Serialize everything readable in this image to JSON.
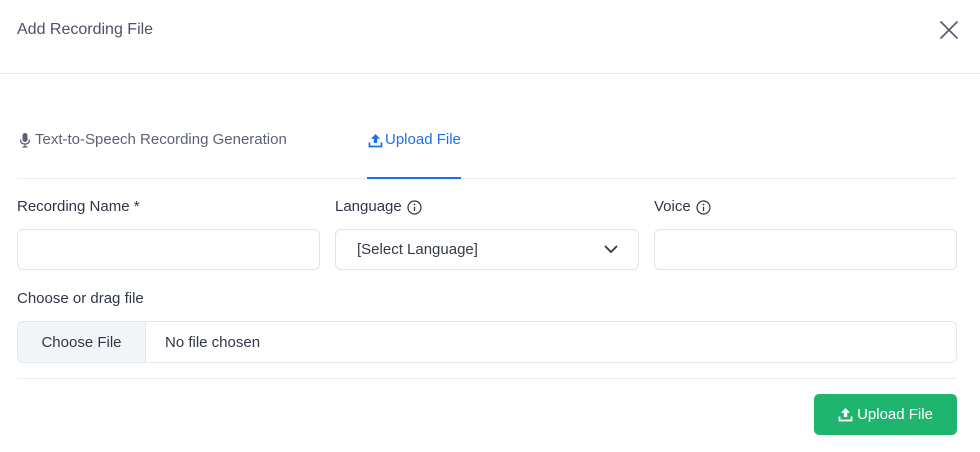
{
  "dialog": {
    "title": "Add Recording File"
  },
  "tabs": [
    {
      "label": "Text-to-Speech Recording Generation",
      "icon": "microphone-icon",
      "active": false
    },
    {
      "label": "Upload File",
      "icon": "upload-icon",
      "active": true
    }
  ],
  "form": {
    "recording_name": {
      "label": "Recording Name *",
      "value": ""
    },
    "language": {
      "label": "Language",
      "selected": "[Select Language]"
    },
    "voice": {
      "label": "Voice",
      "value": ""
    },
    "file": {
      "label": "Choose or drag file",
      "button": "Choose File",
      "status": "No file chosen"
    }
  },
  "actions": {
    "upload_label": "Upload File"
  },
  "colors": {
    "accent": "#1a73e8",
    "primary_button": "#1fb56e"
  }
}
